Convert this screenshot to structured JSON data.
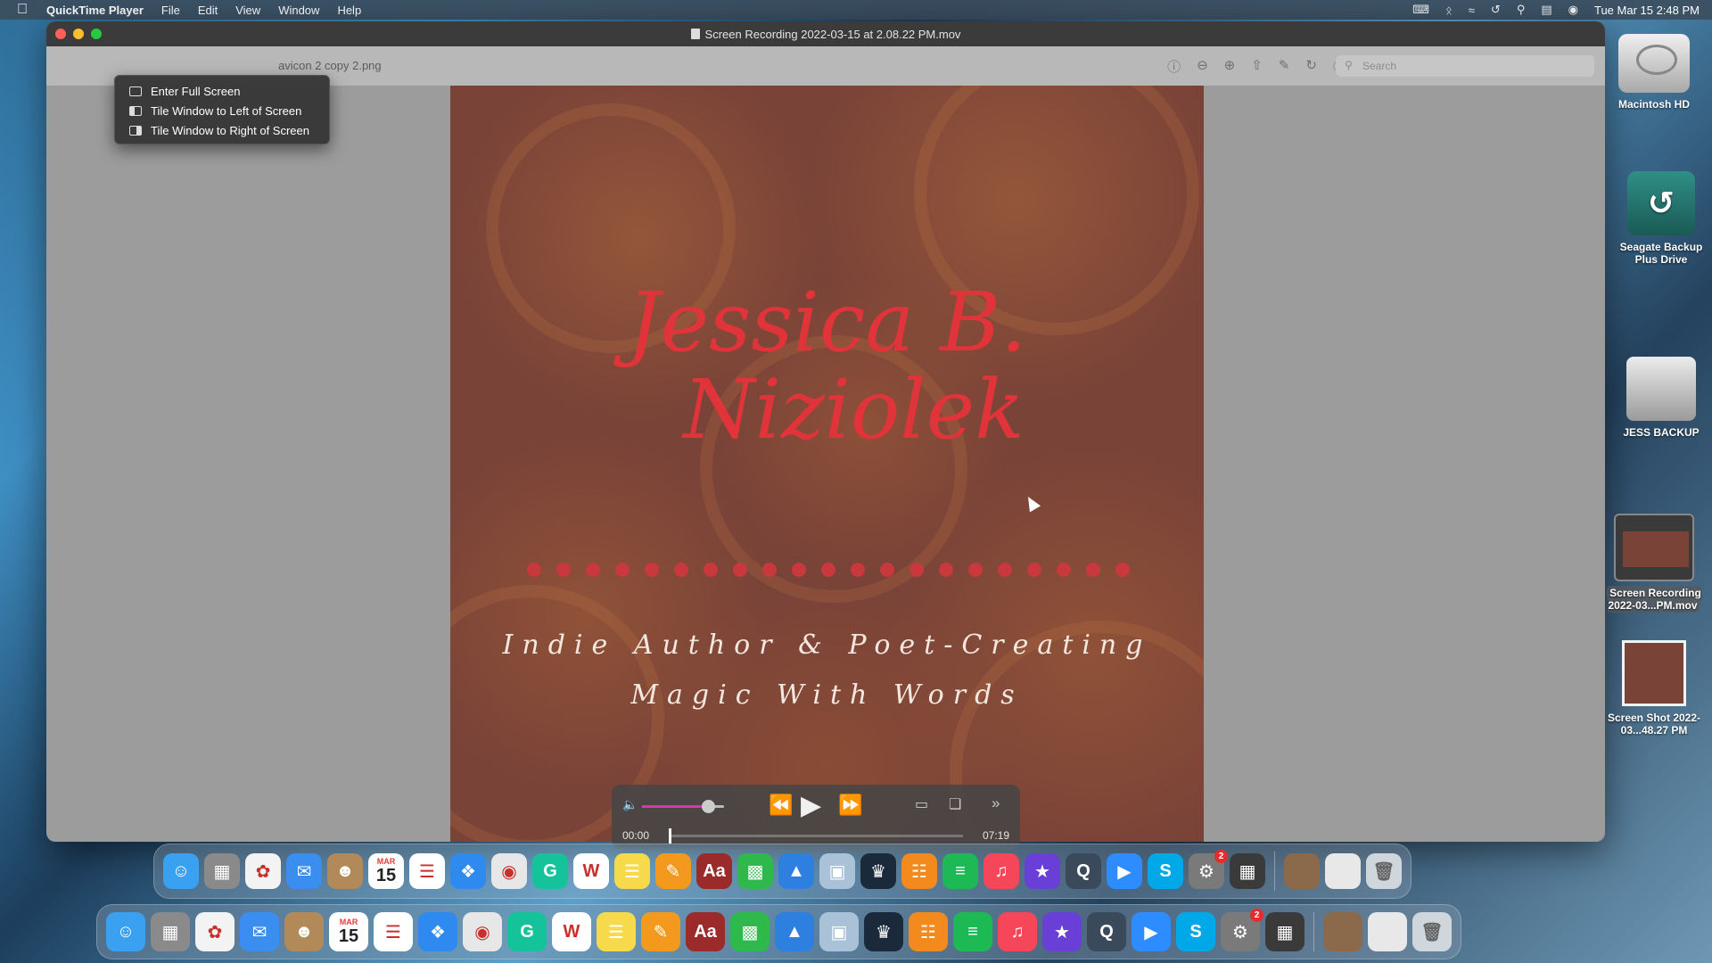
{
  "menubar": {
    "app_name": "QuickTime Player",
    "menus": [
      "File",
      "Edit",
      "View",
      "Window",
      "Help"
    ],
    "clock": "Tue Mar 15  2:48 PM"
  },
  "window": {
    "title": "Screen Recording 2022-03-15 at 2.08.22 PM.mov",
    "behind_document": "avicon 2 copy 2.png",
    "search_placeholder": "Search"
  },
  "window_menu": {
    "items": [
      "Enter Full Screen",
      "Tile Window to Left of Screen",
      "Tile Window to Right of Screen"
    ]
  },
  "video": {
    "author_line1": "Jessica B.",
    "author_line2": "Niziolek",
    "tagline_line1": "Indie Author & Poet-Creating",
    "tagline_line2": "Magic With Words",
    "dot_count": 21,
    "colors": {
      "name": "#e0333a",
      "background": "#7a4338",
      "dots": "#c8383d"
    }
  },
  "playback": {
    "time_current": "00:00",
    "time_total": "07:19",
    "volume_fraction": 0.8,
    "progress_fraction": 0.0,
    "accent_color": "#d33aa8"
  },
  "desktop": {
    "items": [
      {
        "name": "hd",
        "label": "Macintosh HD"
      },
      {
        "name": "backup",
        "label": "Seagate Backup Plus Drive"
      },
      {
        "name": "jess",
        "label": "JESS BACKUP"
      },
      {
        "name": "rec",
        "label": "Screen Recording 2022-03...PM.mov"
      },
      {
        "name": "shot",
        "label": "Screen Shot 2022-03...48.27 PM"
      }
    ]
  },
  "dock_icons": [
    "finder-icon",
    "launchpad-icon",
    "photos-icon",
    "mail-icon",
    "contacts-icon",
    "calendar-icon",
    "reminders-icon",
    "safari-icon",
    "chrome-icon",
    "grammarly-icon",
    "word-icon",
    "notes-icon",
    "pages-icon",
    "dictionary-icon",
    "numbers-icon",
    "keynote-icon",
    "preview-icon",
    "kindle-icon",
    "books-icon",
    "spotify-icon",
    "music-icon",
    "imovie-icon",
    "quicktime-icon",
    "zoom-icon",
    "skype-icon",
    "system-preferences-icon",
    "calculator-icon"
  ],
  "calendar_badge": {
    "month": "MAR",
    "day": "15"
  },
  "system_prefs_badge": "2"
}
